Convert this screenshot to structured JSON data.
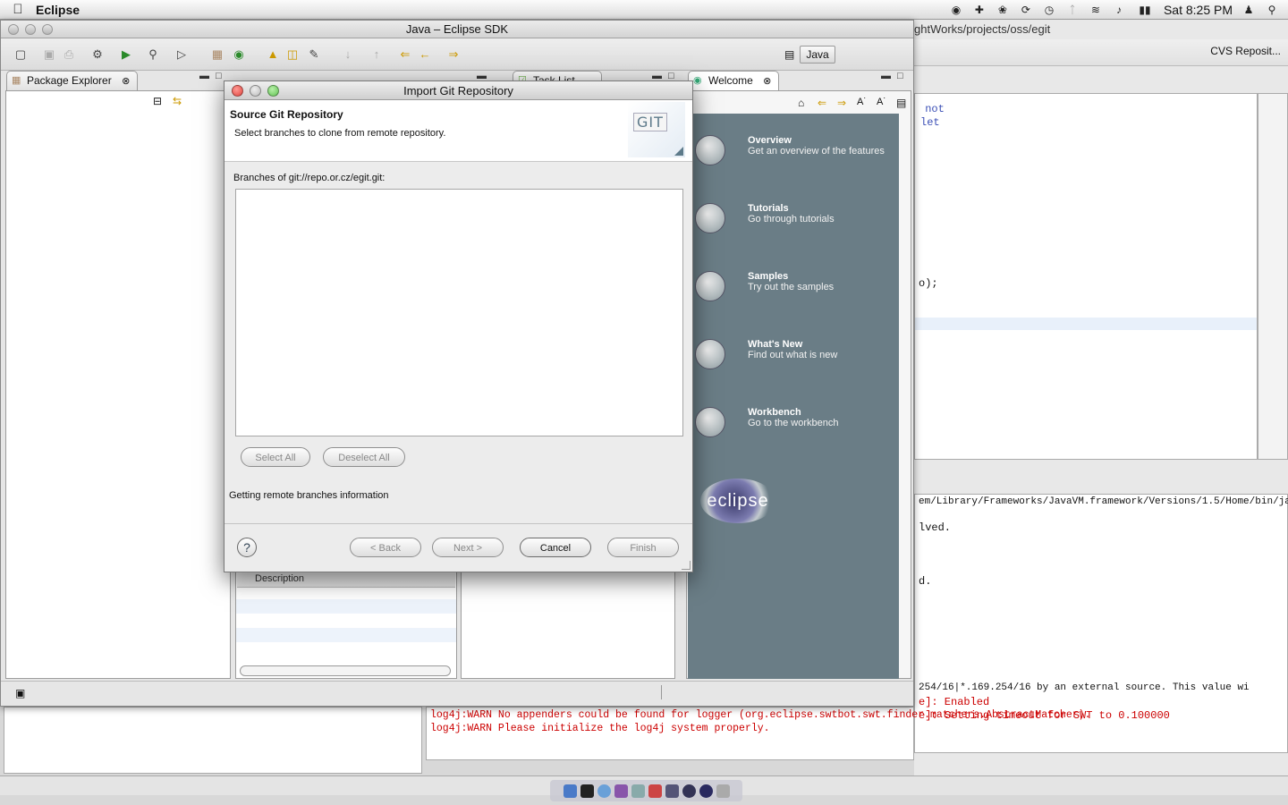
{
  "menubar": {
    "app_name": "Eclipse",
    "clock": "Sat 8:25 PM",
    "icons": [
      "apple-icon",
      "eye-icon",
      "plus-icon",
      "paw-icon",
      "sync-icon",
      "time-machine-icon",
      "bluetooth-icon",
      "wifi-icon",
      "volume-icon",
      "battery-icon",
      "user-icon",
      "spotlight-icon"
    ]
  },
  "bg_window": {
    "title_fragment": "ghtWorks/projects/oss/egit",
    "cvs_button": "CVS Reposit...",
    "editor_lines": [
      " not",
      "let",
      "o);"
    ],
    "console_lines": [
      "em/Library/Frameworks/JavaVM.framework/Versions/1.5/Home/bin/java (Ja",
      "lved.",
      "d.",
      "254/16|*.169.254/16 by an external source. This value wi",
      "e]: Enabled",
      "e]: Setting timeout for SWT to 0.100000"
    ]
  },
  "log": {
    "lines": [
      "log4j:WARN No appenders could be found for logger (org.eclipse.swtbot.swt.finder.matchers.AbstractMatcher).",
      "log4j:WARN Please initialize the log4j system properly."
    ]
  },
  "main_window": {
    "title": "Java – Eclipse SDK",
    "perspective": "Java",
    "tabs": {
      "package_explorer": "Package Explorer",
      "task_list": "Task List",
      "welcome": "Welcome"
    },
    "description_column": "Description"
  },
  "welcome": {
    "items": [
      {
        "title": "Overview",
        "desc": "Get an overview of the features"
      },
      {
        "title": "Tutorials",
        "desc": "Go through tutorials"
      },
      {
        "title": "Samples",
        "desc": "Try out the samples"
      },
      {
        "title": "What's New",
        "desc": "Find out what is new"
      },
      {
        "title": "Workbench",
        "desc": "Go to the workbench"
      }
    ],
    "logo_text": "eclipse"
  },
  "dialog": {
    "title": "Import Git Repository",
    "header_title": "Source Git Repository",
    "header_desc": "Select branches to clone from remote repository.",
    "logo_text": "GIT",
    "branches_label": "Branches of git://repo.or.cz/egit.git:",
    "select_all": "Select All",
    "deselect_all": "Deselect All",
    "status": "Getting remote branches information",
    "back": "< Back",
    "next": "Next >",
    "cancel": "Cancel",
    "finish": "Finish",
    "help": "?"
  },
  "colors": {
    "welcome_bg": "#6a7d86",
    "log_error": "#cc0000",
    "close_light": "#e0443e",
    "min_light": "#dea123",
    "max_light": "#62c254"
  }
}
